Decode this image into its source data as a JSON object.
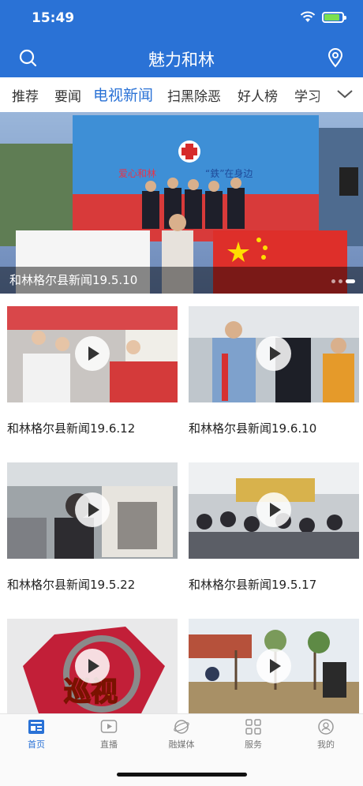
{
  "status_bar": {
    "time": "15:49"
  },
  "header": {
    "title": "魅力和林",
    "search_icon": "search-icon",
    "location_icon": "location-pin-icon"
  },
  "tabs": [
    {
      "label": "推荐",
      "active": false
    },
    {
      "label": "要闻",
      "active": false
    },
    {
      "label": "电视新闻",
      "active": true
    },
    {
      "label": "扫黑除恶",
      "active": false
    },
    {
      "label": "好人榜",
      "active": false
    },
    {
      "label": "学习",
      "active": false
    }
  ],
  "banner": {
    "caption": "和林格尔县新闻19.5.10",
    "stage_text_left": "爱心和林",
    "stage_text_right": "“鉄”在身边"
  },
  "videos": [
    {
      "title": "和林格尔县新闻19.6.12"
    },
    {
      "title": "和林格尔县新闻19.6.10"
    },
    {
      "title": "和林格尔县新闻19.5.22"
    },
    {
      "title": "和林格尔县新闻19.5.17"
    },
    {
      "title": "",
      "overlay_text": "巡视"
    },
    {
      "title": ""
    }
  ],
  "bottom_nav": [
    {
      "label": "首页",
      "icon": "news-icon",
      "active": true
    },
    {
      "label": "直播",
      "icon": "live-play-icon",
      "active": false
    },
    {
      "label": "融媒体",
      "icon": "media-globe-icon",
      "active": false
    },
    {
      "label": "服务",
      "icon": "grid-service-icon",
      "active": false
    },
    {
      "label": "我的",
      "icon": "profile-icon",
      "active": false
    }
  ],
  "colors": {
    "brand_blue": "#2a72d6",
    "battery_green": "#7be04f"
  }
}
